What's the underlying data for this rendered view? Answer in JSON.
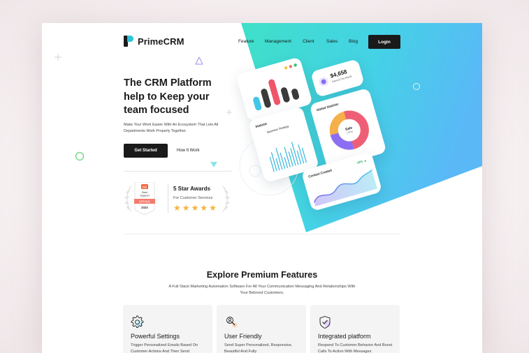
{
  "brand": {
    "name": "PrimeCRM",
    "accent": "#2ec4d6",
    "dark": "#1a1a1a"
  },
  "nav": {
    "items": [
      "Feature",
      "Management",
      "Client",
      "Sales",
      "Blog"
    ],
    "login_label": "Login"
  },
  "hero": {
    "title_lines": [
      "The CRM Platform",
      "help to Keep your",
      "team focused"
    ],
    "subtitle": "Make Your Work Easier With An Ecosystem That Lets All Departments Work Properly Together.",
    "primary_button": "Get Started",
    "secondary_button": "How It Work"
  },
  "award": {
    "badge_top": "G2",
    "badge_line1": "Best",
    "badge_line2": "Support",
    "badge_ribbon": "SPRING",
    "badge_year": "202X",
    "title": "5 Star Awards",
    "subtitle": "For Customer Services",
    "stars": 5
  },
  "dashboard": {
    "earnings": {
      "amount": "$4,658",
      "caption": "Earned This Month"
    },
    "statistic": {
      "label": "Statistic",
      "chart_title": "Business Strategy"
    },
    "global": {
      "label": "Global Statistic",
      "center_title": "Sale",
      "center_value": "(70%)"
    },
    "contact": {
      "label": "Contact Created",
      "change": "18% ▲"
    }
  },
  "features": {
    "title": "Explore Premium Features",
    "subtitle": "A Full Stack Marketing Automation Software For All Your Communication Messaging And Relationships With Your Beloved Customers.",
    "cards": [
      {
        "icon": "gear-icon",
        "title": "Powerful Settings",
        "desc": "Trigger Personalized Emails Based On Customer Actions And Then Send"
      },
      {
        "icon": "user-search-icon",
        "title": "User Friendly",
        "desc": "Send Super Personalized, Responsive, Beautiful And Fully"
      },
      {
        "icon": "shield-check-icon",
        "title": "Integrated platform",
        "desc": "Respond To Customer Behavior And Boost Calls To Action With Messages"
      }
    ]
  }
}
